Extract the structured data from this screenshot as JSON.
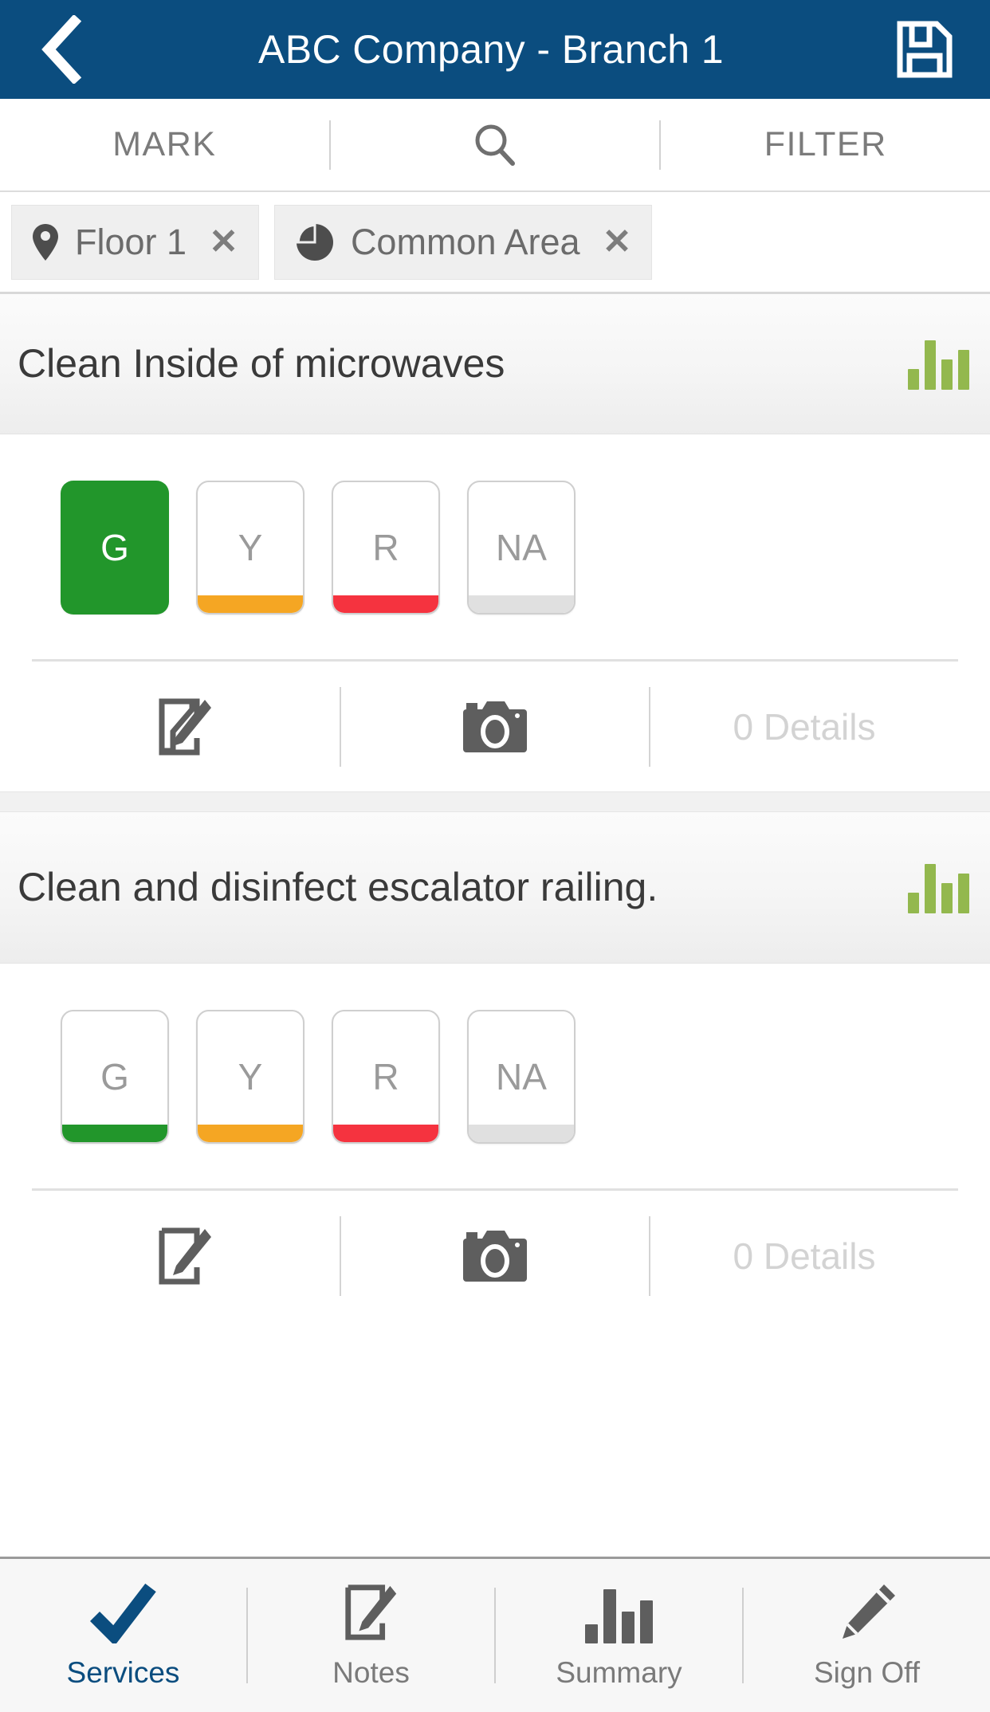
{
  "header": {
    "title": "ABC Company - Branch 1",
    "back_icon": "chevron-left-icon",
    "save_icon": "save-floppy-icon",
    "bg_color": "#0b4d7f"
  },
  "toolbar": {
    "mark_label": "MARK",
    "search_icon": "search-icon",
    "filter_label": "FILTER"
  },
  "filters": [
    {
      "icon": "map-pin-icon",
      "label": "Floor 1",
      "remove_label": "✕"
    },
    {
      "icon": "pie-chart-icon",
      "label": "Common Area",
      "remove_label": "✕"
    }
  ],
  "ratings_legend": {
    "green": "G",
    "yellow": "Y",
    "red": "R",
    "na": "NA",
    "green_color": "#22962b",
    "yellow_color": "#f5a623",
    "red_color": "#f5333f",
    "na_color": "#e0e0e0"
  },
  "tasks": [
    {
      "title": "Clean Inside of microwaves",
      "chart_icon": "bar-chart-icon",
      "selected_rating": "G",
      "ratings": [
        {
          "label": "G",
          "color": "#22962b"
        },
        {
          "label": "Y",
          "color": "#f5a623"
        },
        {
          "label": "R",
          "color": "#f5333f"
        },
        {
          "label": "NA",
          "color": "#e0e0e0"
        }
      ],
      "actions": {
        "note_icon": "note-edit-icon",
        "camera_icon": "camera-icon",
        "details_label": "0 Details"
      }
    },
    {
      "title": "Clean and disinfect escalator railing.",
      "chart_icon": "bar-chart-icon",
      "selected_rating": "",
      "ratings": [
        {
          "label": "G",
          "color": "#22962b"
        },
        {
          "label": "Y",
          "color": "#f5a623"
        },
        {
          "label": "R",
          "color": "#f5333f"
        },
        {
          "label": "NA",
          "color": "#e0e0e0"
        }
      ],
      "actions": {
        "note_icon": "note-edit-icon",
        "camera_icon": "camera-icon",
        "details_label": "0 Details"
      }
    }
  ],
  "bottom_nav": {
    "active": "Services",
    "items": [
      {
        "label": "Services",
        "icon": "check-icon"
      },
      {
        "label": "Notes",
        "icon": "note-edit-icon"
      },
      {
        "label": "Summary",
        "icon": "bar-chart-icon"
      },
      {
        "label": "Sign Off",
        "icon": "pencil-icon"
      }
    ]
  }
}
